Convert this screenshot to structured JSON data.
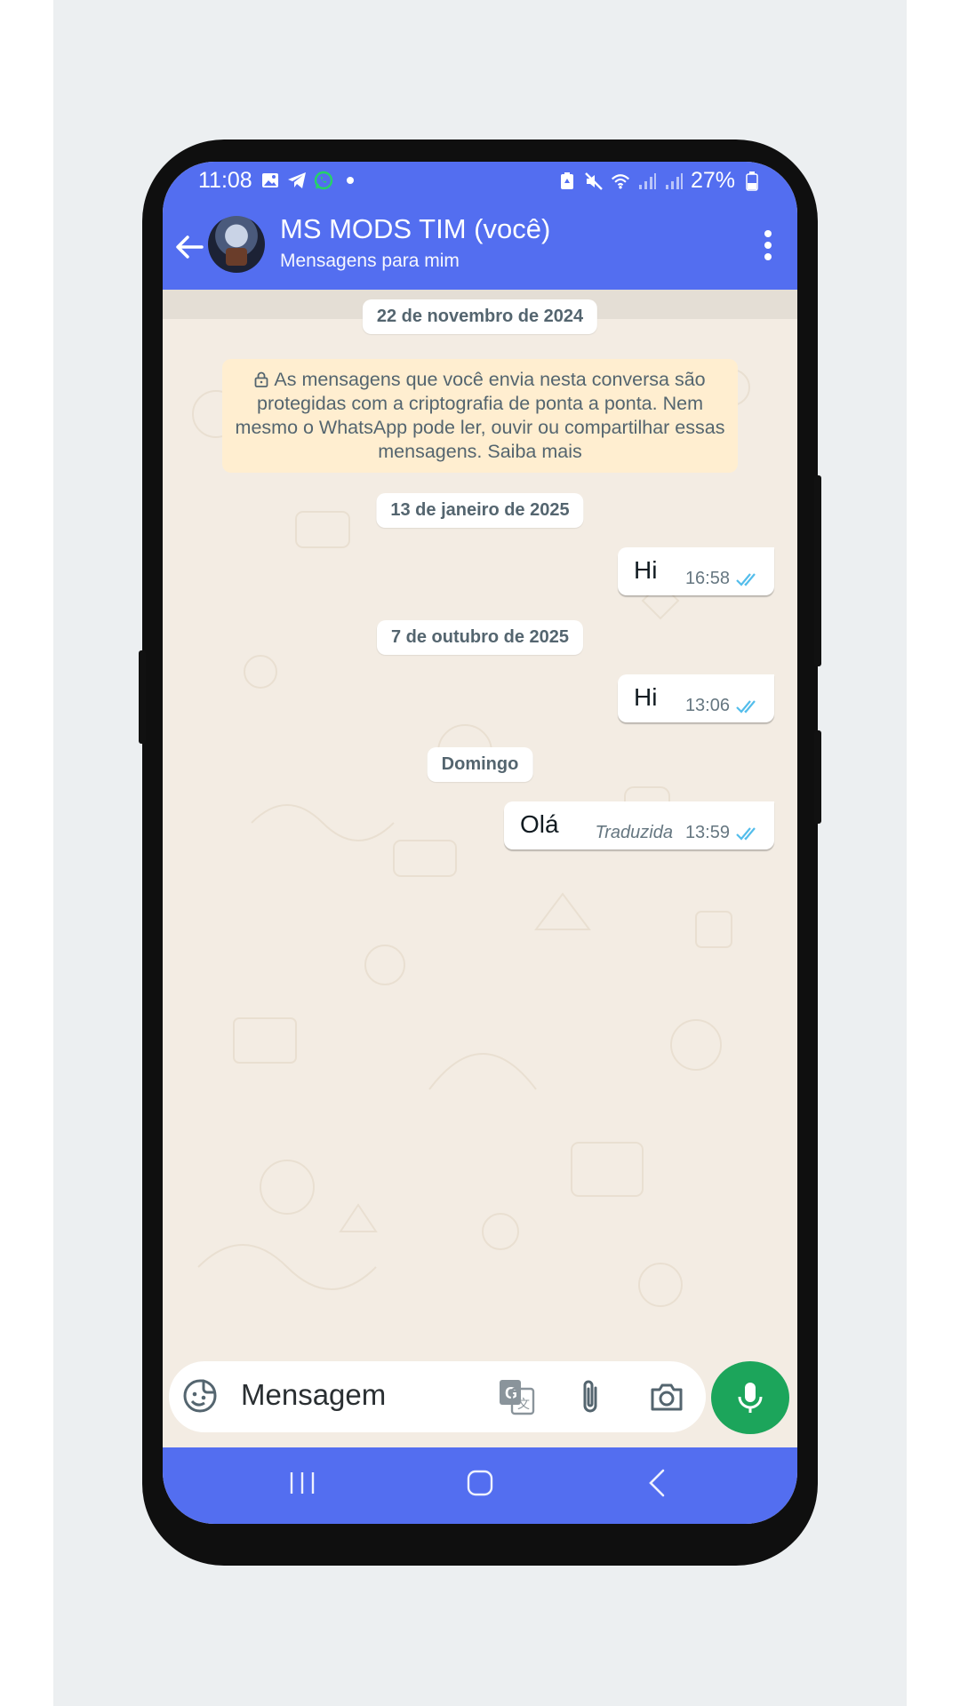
{
  "status_bar": {
    "time": "11:08",
    "battery": "27%",
    "left_icons": [
      "gallery-icon",
      "telegram-icon",
      "whatsapp-icon",
      "dot-icon"
    ],
    "right_icons": [
      "battery-saver-icon",
      "mute-icon",
      "wifi-icon",
      "signal-icon",
      "signal-icon",
      "battery-icon"
    ]
  },
  "header": {
    "contact_name": "MS MODS TIM (você)",
    "subtitle": "Mensagens para mim"
  },
  "chat": {
    "date_1": "22 de novembro de 2024",
    "security_notice": "As mensagens que você envia nesta conversa são protegidas com a criptografia de ponta a ponta. Nem mesmo o WhatsApp pode ler, ouvir ou compartilhar essas mensagens. Saiba mais",
    "date_2": "13 de janeiro de 2025",
    "date_3": "7 de outubro de 2025",
    "date_4": "Domingo",
    "messages": [
      {
        "text": "Hi",
        "time": "16:58",
        "status": "read"
      },
      {
        "text": "Hi",
        "time": "13:06",
        "status": "read"
      },
      {
        "text": "Olá",
        "translated_label": "Traduzida",
        "time": "13:59",
        "status": "read"
      }
    ]
  },
  "composer": {
    "placeholder": "Mensagem"
  },
  "colors": {
    "accent": "#536ef0",
    "mic_button": "#1ca55b",
    "read_ticks": "#53bdeb",
    "chat_background": "#f3ece3",
    "notice_background": "#ffeed0"
  }
}
